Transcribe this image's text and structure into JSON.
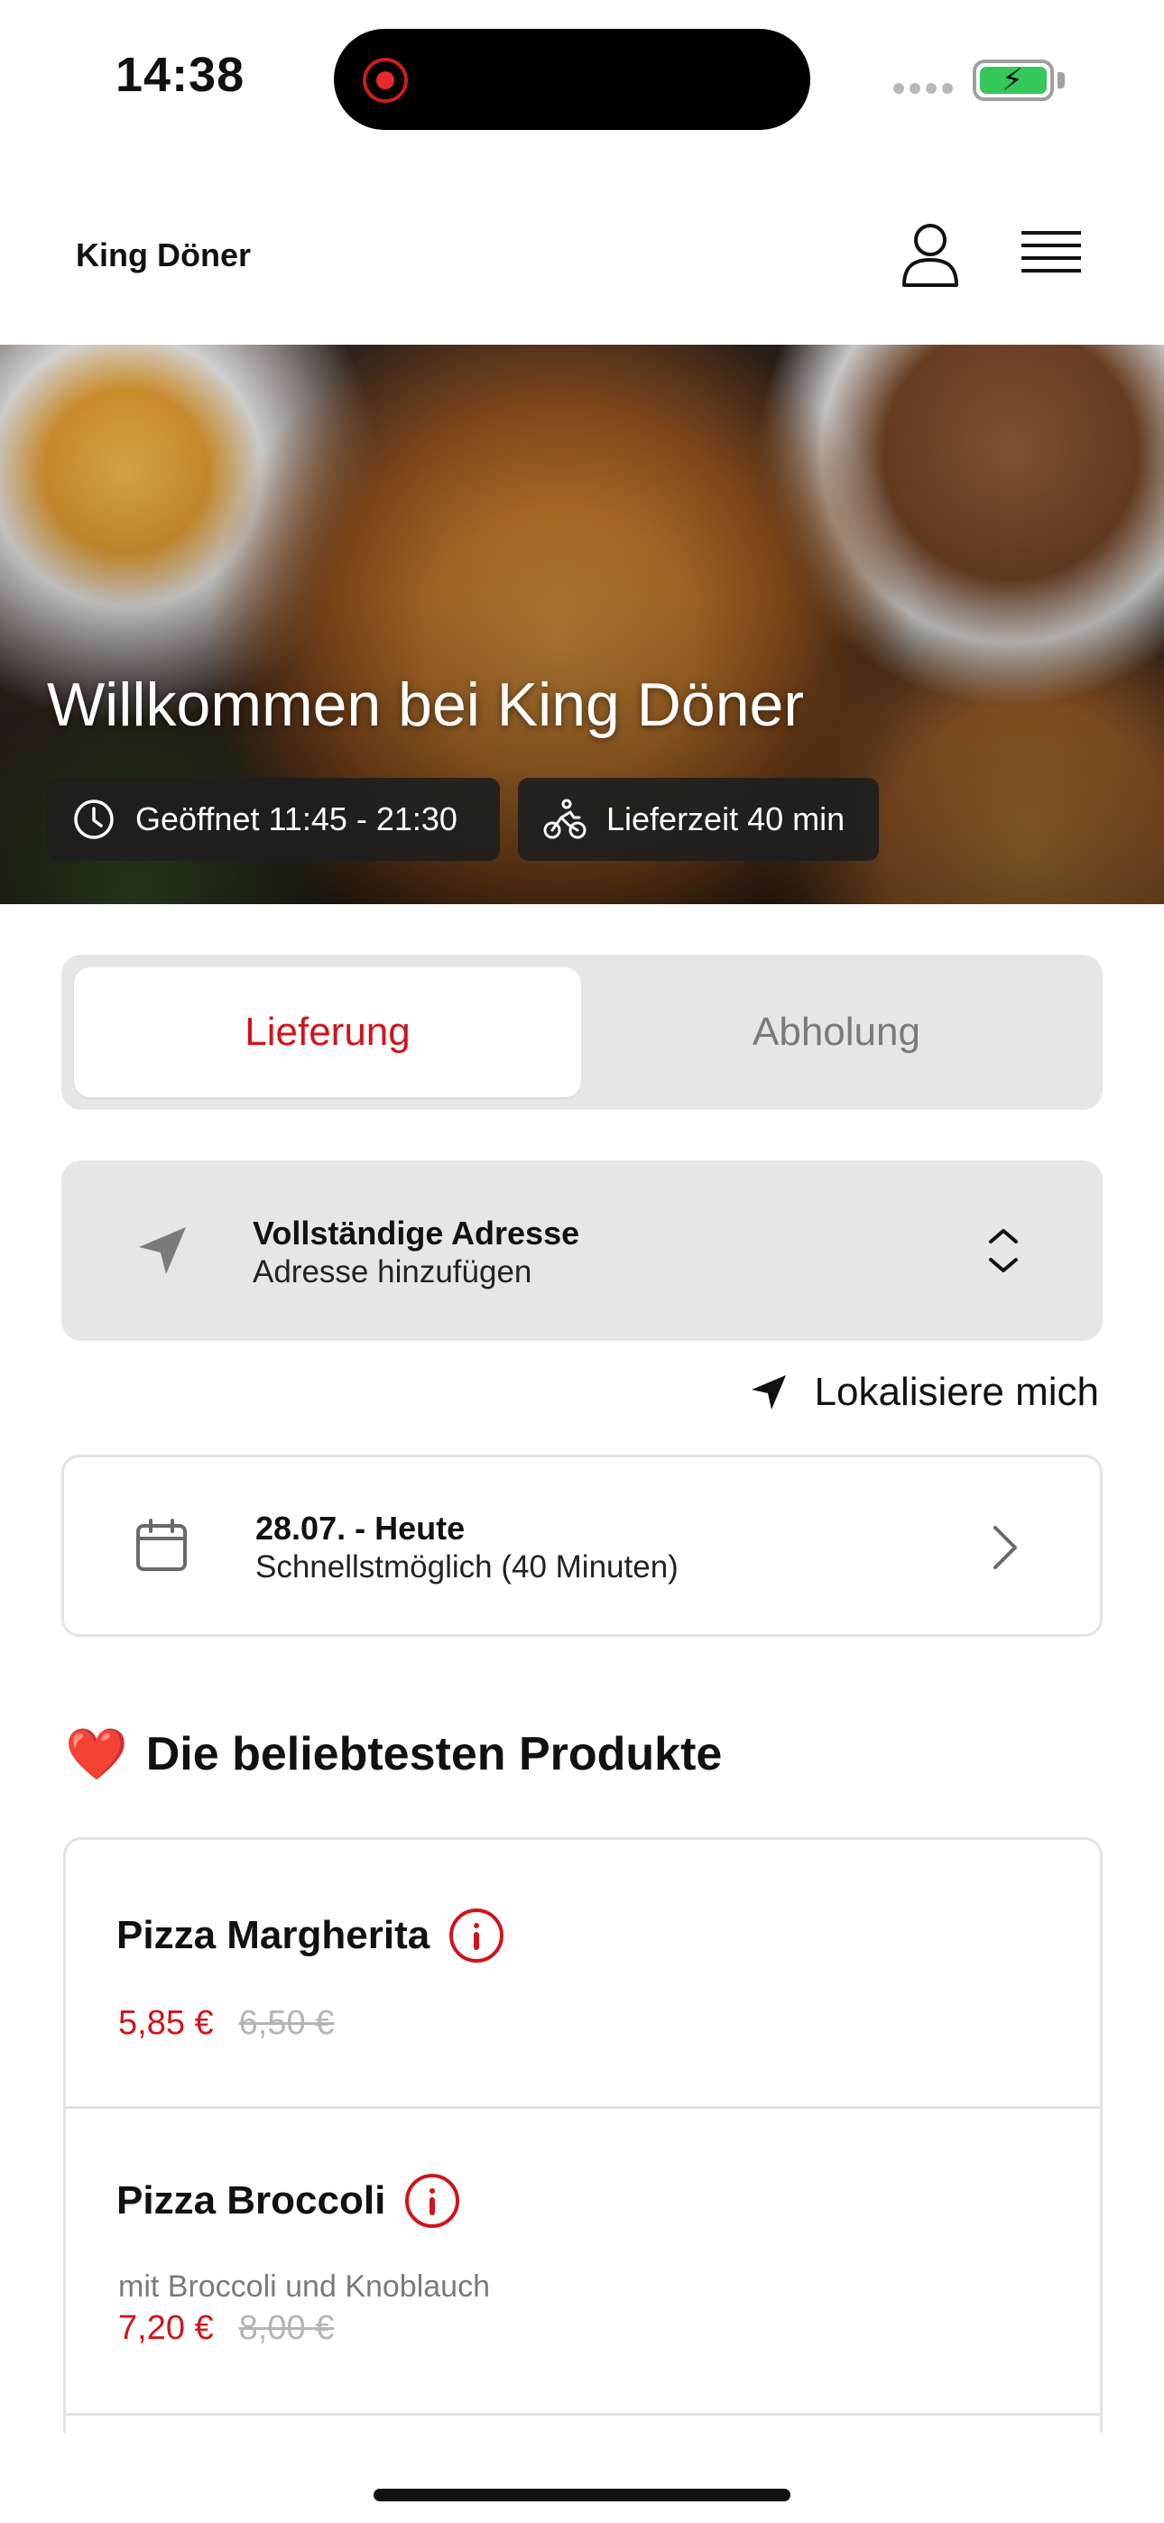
{
  "status_bar": {
    "time": "14:38",
    "battery_state": "charging"
  },
  "header": {
    "brand": "King Döner",
    "icons": [
      "user-icon",
      "menu-icon"
    ]
  },
  "hero": {
    "title": "Willkommen bei King Döner",
    "opening_hours": "Geöffnet 11:45 - 21:30",
    "delivery_time": "Lieferzeit 40 min"
  },
  "order_mode": {
    "options": [
      "Lieferung",
      "Abholung"
    ],
    "selected": "Lieferung"
  },
  "address": {
    "title": "Vollständige Adresse",
    "subtitle": "Adresse hinzufügen"
  },
  "locate_me": "Lokalisiere mich",
  "date": {
    "title": "28.07. - Heute",
    "subtitle": "Schnellstmöglich (40 Minuten)"
  },
  "popular": {
    "heart": "❤️",
    "title": "Die beliebtesten Produkte",
    "products": [
      {
        "name": "Pizza Margherita",
        "description": "",
        "price": "5,85 €",
        "old_price": "6,50 €"
      },
      {
        "name": "Pizza Broccoli",
        "description": "mit Broccoli und Knoblauch",
        "price": "7,20 €",
        "old_price": "8,00 €"
      }
    ]
  },
  "colors": {
    "accent": "#d0141a",
    "segment_bg": "#e6e6e6",
    "muted_text": "#7a7a7a",
    "old_price": "#b5b5b5"
  }
}
